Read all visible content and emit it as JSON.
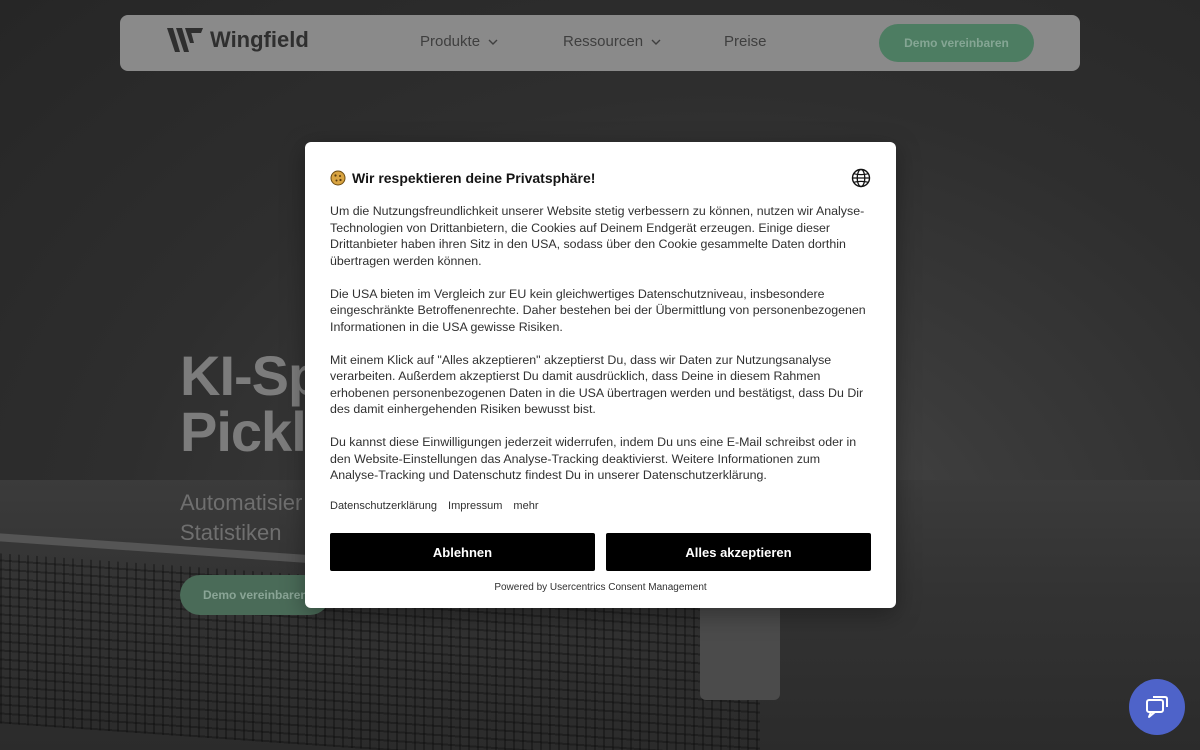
{
  "navbar": {
    "logo_text": "Wingfield",
    "items": [
      {
        "label": "Produkte",
        "has_dropdown": true
      },
      {
        "label": "Ressourcen",
        "has_dropdown": true
      },
      {
        "label": "Preise",
        "has_dropdown": false
      }
    ],
    "cta_label": "Demo vereinbaren"
  },
  "hero": {
    "title": "KI-Sp\nPickle",
    "subtitle": "Automatisier\nStatistiken",
    "cta_label": "Demo vereinbaren"
  },
  "consent": {
    "title": "Wir respektieren deine Privatsphäre!",
    "icon_left": "cookie-icon",
    "icon_right": "globe-icon",
    "paragraphs": [
      "Um die Nutzungsfreundlichkeit unserer Website stetig verbessern zu können, nutzen wir Analyse-Technologien von Drittanbietern, die Cookies auf Deinem Endgerät erzeugen. Einige dieser Drittanbieter haben ihren Sitz in den USA, sodass über den Cookie gesammelte Daten dorthin übertragen werden können.",
      "Die USA bieten im Vergleich zur EU kein gleichwertiges Datenschutzniveau, insbesondere eingeschränkte Betroffenenrechte. Daher bestehen bei der Übermittlung von personenbezogenen Informationen in die USA gewisse Risiken.",
      "Mit einem Klick auf \"Alles akzeptieren\" akzeptierst Du, dass wir Daten zur Nutzungsanalyse verarbeiten. Außerdem akzeptierst Du damit ausdrücklich, dass Deine in diesem Rahmen erhobenen personenbezogenen Daten in die USA übertragen werden und bestätigst, dass Du Dir des damit einhergehenden Risiken bewusst bist.",
      "Du kannst diese Einwilligungen jederzeit widerrufen, indem Du uns eine E-Mail schreibst oder in den Website-Einstellungen das Analyse-Tracking deaktivierst. Weitere Informationen zum Analyse-Tracking und Datenschutz findest Du in unserer Datenschutzerklärung."
    ],
    "links": {
      "privacy": "Datenschutzerklärung",
      "imprint": "Impressum",
      "more": "mehr"
    },
    "buttons": {
      "deny": "Ablehnen",
      "accept": "Alles akzeptieren"
    },
    "powered_by": "Powered by Usercentrics Consent Management"
  },
  "chat": {
    "icon": "chat-icon",
    "color": "#4e63c9"
  },
  "colors": {
    "brand_green": "#4d7d62",
    "button_black": "#000000",
    "chat_blue": "#4e63c9"
  }
}
